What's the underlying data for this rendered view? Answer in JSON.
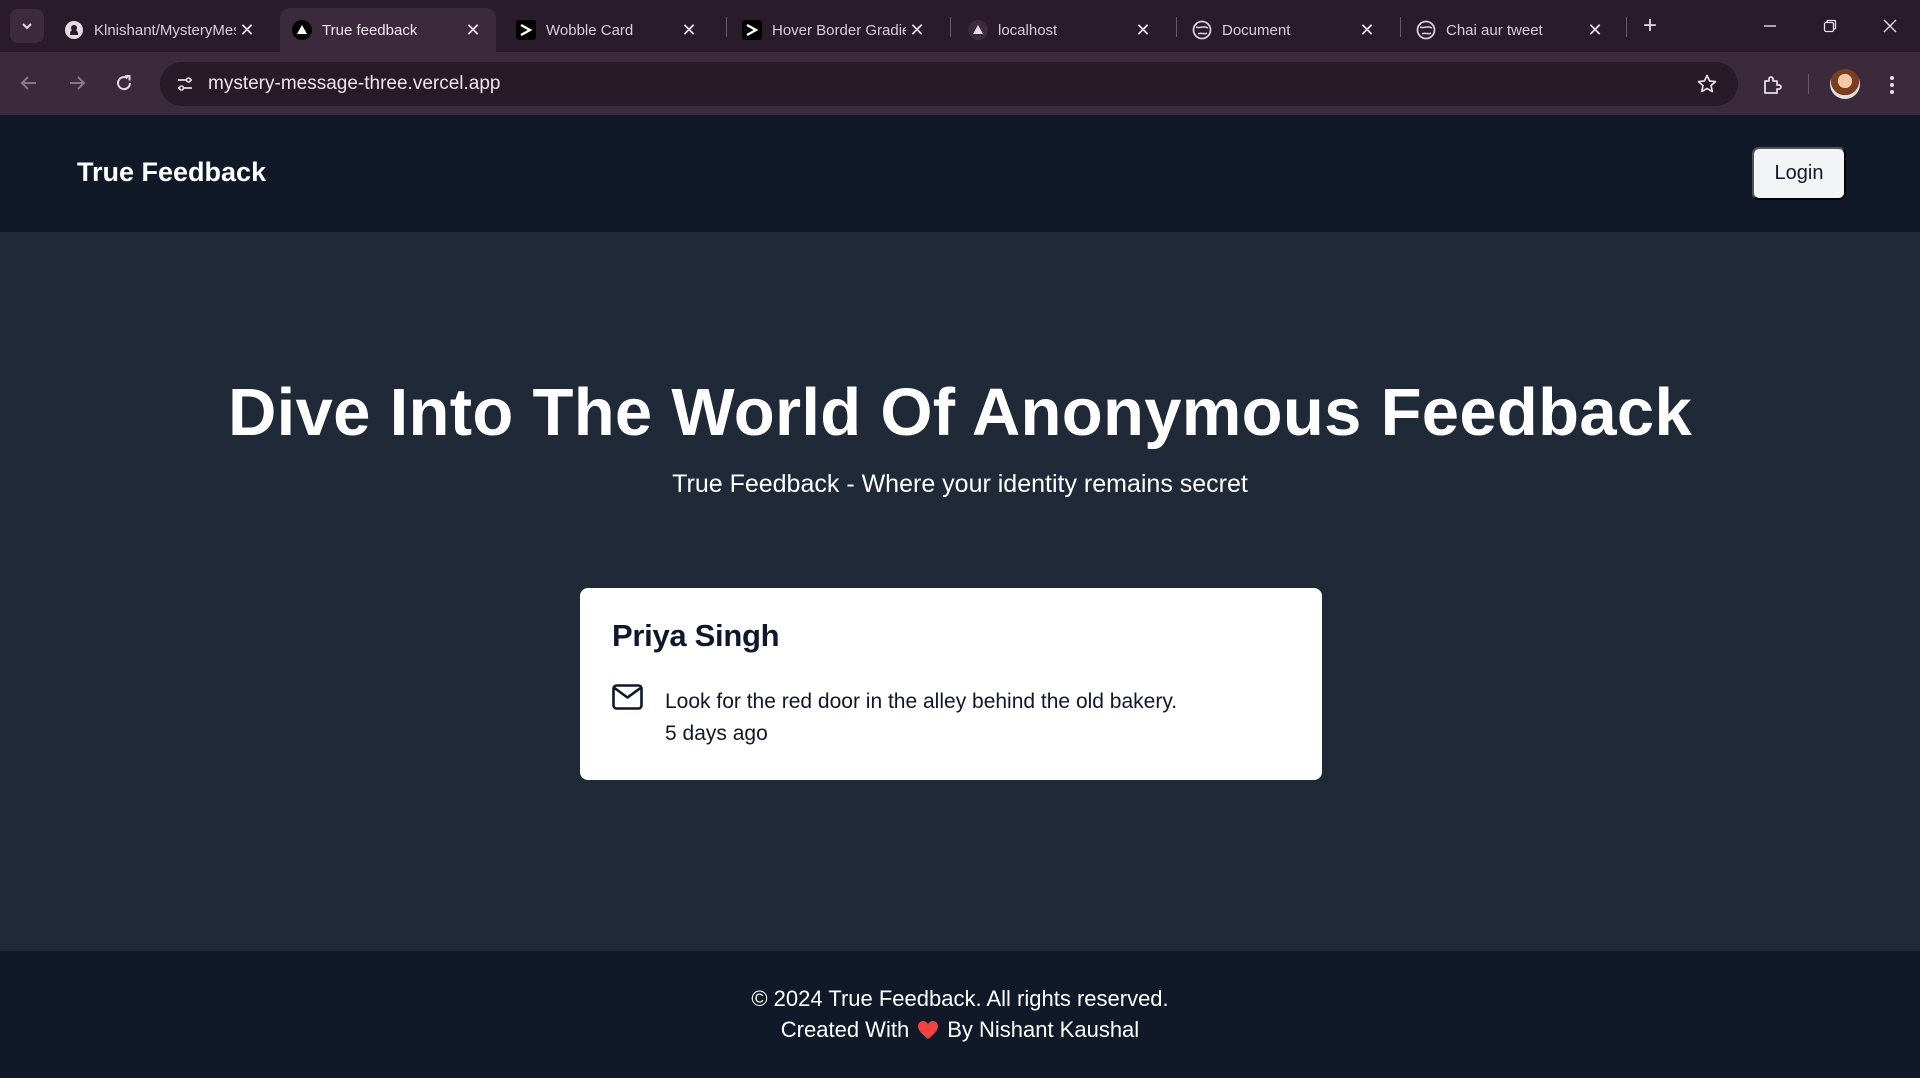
{
  "browser": {
    "tabs": [
      {
        "title": "Klnishant/MysteryMessage",
        "favicon": "github-icon",
        "active": false
      },
      {
        "title": "True feedback",
        "favicon": "vercel-icon",
        "active": true
      },
      {
        "title": "Wobble Card",
        "favicon": "aceternity-icon",
        "active": false
      },
      {
        "title": "Hover Border Gradient",
        "favicon": "aceternity-icon",
        "active": false
      },
      {
        "title": "localhost",
        "favicon": "vercel-icon",
        "active": false
      },
      {
        "title": "Document",
        "favicon": "globe-icon",
        "active": false
      },
      {
        "title": "Chai aur tweet",
        "favicon": "globe-icon",
        "active": false
      }
    ],
    "url": "mystery-message-three.vercel.app"
  },
  "nav": {
    "brand": "True Feedback",
    "login_label": "Login"
  },
  "hero": {
    "title": "Dive Into The World Of Anonymous Feedback",
    "subtitle": "True Feedback - Where your identity remains secret"
  },
  "card": {
    "name": "Priya Singh",
    "message": "Look for the red door in the alley behind the old bakery.",
    "time": "5 days ago"
  },
  "footer": {
    "copyright": "© 2024 True Feedback. All rights reserved.",
    "created_prefix": "Created With",
    "created_suffix": "By Nishant Kaushal"
  },
  "colors": {
    "nav_bg": "#111827",
    "main_bg": "#1f2937",
    "card_bg": "#ffffff",
    "heart": "#ef4444"
  }
}
